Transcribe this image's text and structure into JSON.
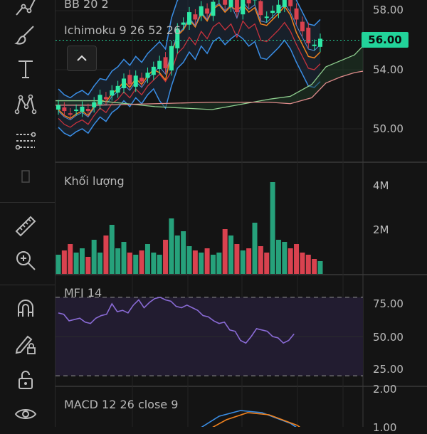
{
  "indicators": {
    "bb": "BB 20 2",
    "ichimoku": "Ichimoku 9 26 52 26",
    "volume": "Khối lượng",
    "mfi": "MFI 14",
    "macd": "MACD 12 26 close 9"
  },
  "price_axis": {
    "labels": [
      "58.00",
      "54.00",
      "50.00"
    ],
    "current_price": "56.00"
  },
  "volume_axis": {
    "labels": [
      "4M",
      "2M"
    ]
  },
  "mfi_axis": {
    "labels": [
      "75.00",
      "50.00",
      "25.00"
    ]
  },
  "macd_axis": {
    "labels": [
      "2.00",
      "1.00"
    ]
  },
  "colors": {
    "up": "#26a17b",
    "down": "#d9424f",
    "up_bright": "#2ee8a5",
    "accent_badge": "#22d39a",
    "bb_line": "#3a8ee6",
    "mfi_line": "#8a6bd6",
    "macd_line": "#3a8ee6",
    "signal_line": "#f0821e"
  },
  "icons": [
    "trendline-icon",
    "brush-icon",
    "text-icon",
    "pattern-icon",
    "fib-icon",
    "empty-icon",
    "ruler-icon",
    "zoom-in-icon",
    "magnet-icon",
    "lock-pencil-icon",
    "unlock-icon",
    "eye-icon"
  ]
}
